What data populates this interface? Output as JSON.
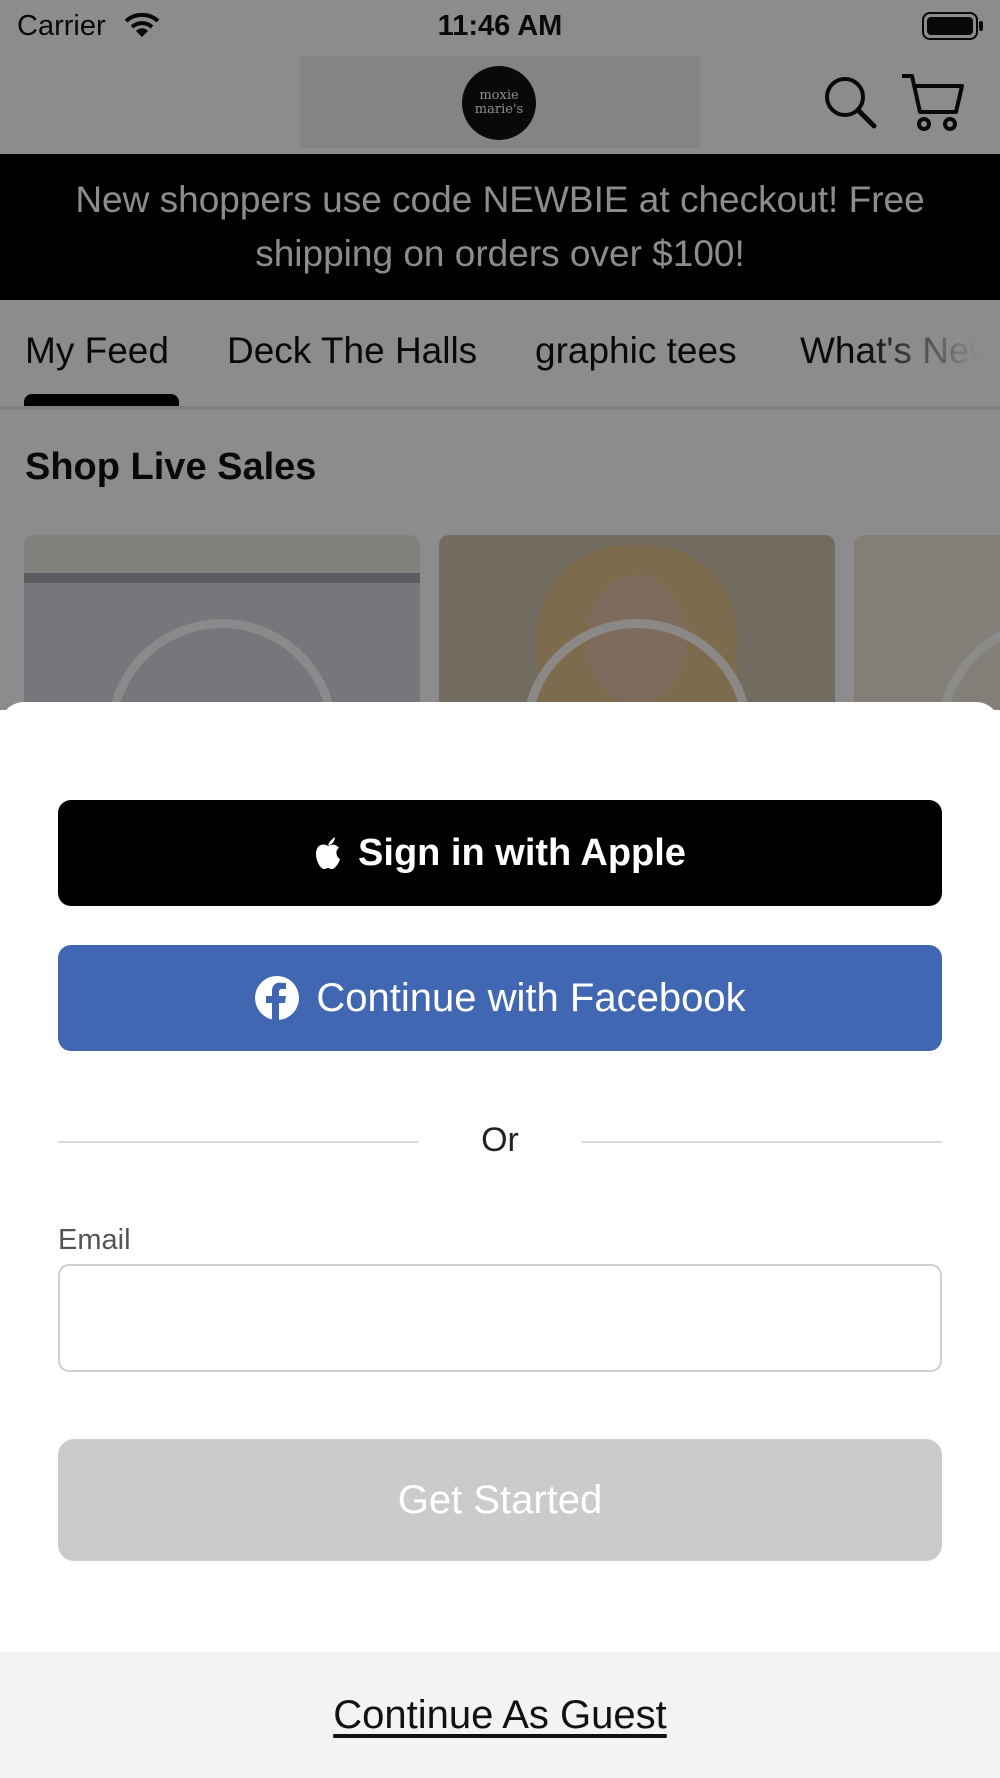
{
  "status_bar": {
    "carrier": "Carrier",
    "time": "11:46 AM"
  },
  "header": {
    "logo_text": "moxie marie's"
  },
  "banner": {
    "text": "New shoppers use code NEWBIE at checkout! Free shipping on orders over $100!"
  },
  "tabs": [
    {
      "label": "My Feed",
      "active": true
    },
    {
      "label": "Deck The Halls",
      "active": false
    },
    {
      "label": "graphic tees",
      "active": false
    },
    {
      "label": "What's New",
      "active": false
    }
  ],
  "feed": {
    "section_title": "Shop Live Sales"
  },
  "signin_sheet": {
    "apple_button": "Sign in with Apple",
    "facebook_button": "Continue with Facebook",
    "divider_text": "Or",
    "email_label": "Email",
    "email_value": "",
    "get_started_button": "Get Started",
    "guest_link": "Continue As Guest"
  },
  "colors": {
    "facebook_blue": "#4267b2",
    "apple_black": "#000000",
    "disabled_button": "#cbcbcb",
    "banner_bg": "#000000"
  }
}
